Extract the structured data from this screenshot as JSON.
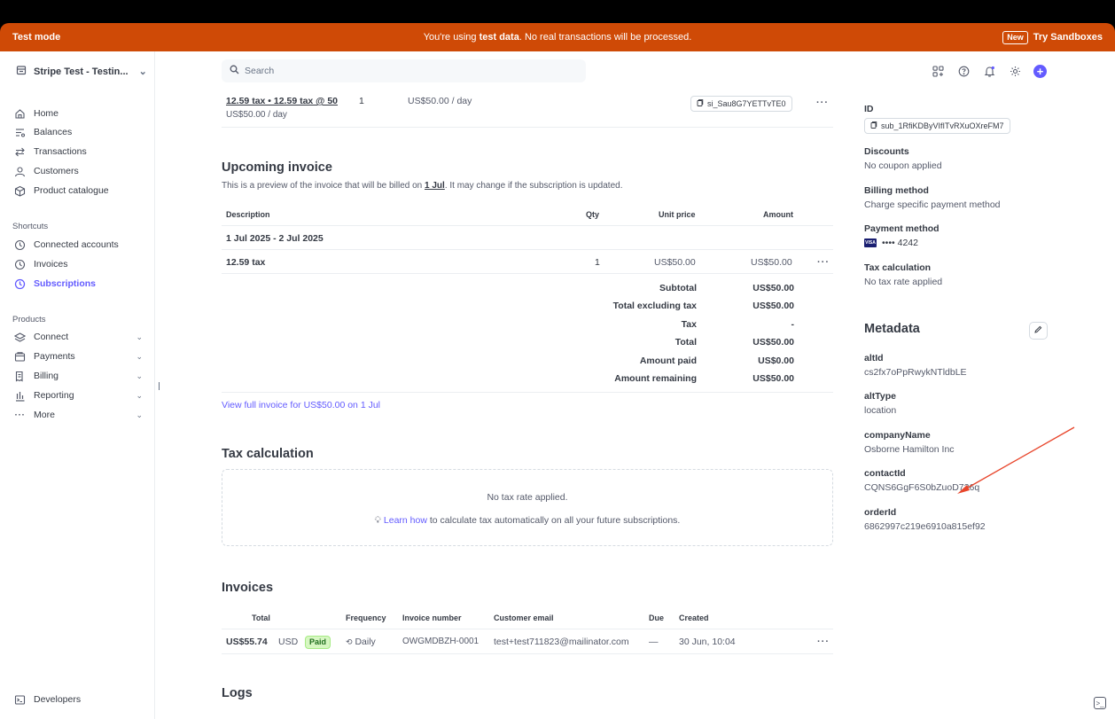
{
  "banner": {
    "mode": "Test mode",
    "message_pre": "You're using ",
    "message_bold": "test data",
    "message_post": ". No real transactions will be processed.",
    "new_badge": "New",
    "try_sandboxes": "Try Sandboxes",
    "color": "#cf4a06"
  },
  "sidebar": {
    "account_name": "Stripe Test - Testin...",
    "main_items": [
      {
        "label": "Home",
        "icon": "home-icon"
      },
      {
        "label": "Balances",
        "icon": "balances-icon"
      },
      {
        "label": "Transactions",
        "icon": "transactions-icon"
      },
      {
        "label": "Customers",
        "icon": "customers-icon"
      },
      {
        "label": "Product catalogue",
        "icon": "product-catalogue-icon"
      }
    ],
    "shortcuts_label": "Shortcuts",
    "shortcuts": [
      {
        "label": "Connected accounts",
        "icon": "clock-icon"
      },
      {
        "label": "Invoices",
        "icon": "clock-icon"
      },
      {
        "label": "Subscriptions",
        "icon": "clock-icon",
        "active": true
      }
    ],
    "products_label": "Products",
    "products": [
      {
        "label": "Connect",
        "icon": "connect-icon"
      },
      {
        "label": "Payments",
        "icon": "payments-icon"
      },
      {
        "label": "Billing",
        "icon": "billing-icon"
      },
      {
        "label": "Reporting",
        "icon": "reporting-icon"
      },
      {
        "label": "More",
        "icon": "more-icon"
      }
    ],
    "developers": "Developers",
    "accent": "#635bff"
  },
  "search": {
    "placeholder": "Search"
  },
  "subscription_item": {
    "name": "12.59 tax • 12.59 tax @ 50",
    "sub": "US$50.00 / day",
    "qty": "1",
    "price": "US$50.00 / day",
    "item_id": "si_Sau8G7YETTvTE0"
  },
  "upcoming": {
    "title": "Upcoming invoice",
    "desc_pre": "This is a preview of the invoice that will be billed on ",
    "desc_date": "1 Jul",
    "desc_post": ". It may change if the subscription is updated.",
    "headers": {
      "description": "Description",
      "qty": "Qty",
      "unit_price": "Unit price",
      "amount": "Amount"
    },
    "period": "1 Jul 2025 - 2 Jul 2025",
    "line": {
      "description": "12.59 tax",
      "qty": "1",
      "unit_price": "US$50.00",
      "amount": "US$50.00"
    },
    "summary": [
      {
        "label": "Subtotal",
        "value": "US$50.00"
      },
      {
        "label": "Total excluding tax",
        "value": "US$50.00"
      },
      {
        "label": "Tax",
        "value": "-"
      },
      {
        "label": "Total",
        "value": "US$50.00"
      },
      {
        "label": "Amount paid",
        "value": "US$0.00"
      },
      {
        "label": "Amount remaining",
        "value": "US$50.00"
      }
    ],
    "view_link": "View full invoice for US$50.00 on 1 Jul"
  },
  "tax_calc": {
    "title": "Tax calculation",
    "empty": "No tax rate applied.",
    "learn_link": "Learn how",
    "learn_rest": " to calculate tax automatically on all your future subscriptions."
  },
  "invoices": {
    "title": "Invoices",
    "headers": {
      "total": "Total",
      "frequency": "Frequency",
      "number": "Invoice number",
      "email": "Customer email",
      "due": "Due",
      "created": "Created"
    },
    "rows": [
      {
        "total": "US$55.74",
        "currency": "USD",
        "status": "Paid",
        "frequency": "Daily",
        "number": "OWGMDBZH-0001",
        "email": "test+test711823@mailinator.com",
        "due": "—",
        "created": "30 Jun, 10:04"
      }
    ]
  },
  "logs": {
    "title": "Logs"
  },
  "details": {
    "id_label": "ID",
    "id_value": "sub_1RfiKDByVIfITvRXuOXreFM7",
    "discounts_label": "Discounts",
    "discounts_value": "No coupon applied",
    "billing_label": "Billing method",
    "billing_value": "Charge specific payment method",
    "payment_label": "Payment method",
    "card_brand": "VISA",
    "card_last4": "•••• 4242",
    "taxcalc_label": "Tax calculation",
    "taxcalc_value": "No tax rate applied"
  },
  "metadata": {
    "title": "Metadata",
    "entries": [
      {
        "key": "altId",
        "value": "cs2fx7oPpRwykNTldbLE"
      },
      {
        "key": "altType",
        "value": "location"
      },
      {
        "key": "companyName",
        "value": "Osborne Hamilton Inc"
      },
      {
        "key": "contactId",
        "value": "CQNS6GgF6S0bZuoD726q"
      },
      {
        "key": "orderId",
        "value": "6862997c219e6910a815ef92"
      }
    ]
  },
  "annotation": {
    "arrow_color": "#e8452b"
  }
}
